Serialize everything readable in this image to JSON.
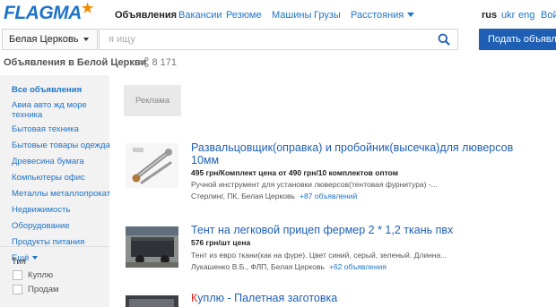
{
  "logo": {
    "text": "FLAGMA",
    "star": "★"
  },
  "nav": [
    {
      "label": "Объявления",
      "active": true
    },
    {
      "label": "Вакансии"
    },
    {
      "label": "Резюме"
    },
    {
      "label": "Машины"
    },
    {
      "label": "Грузы"
    },
    {
      "label": "Расстояния"
    }
  ],
  "langs": [
    "rus",
    "ukr",
    "eng"
  ],
  "login": "Вой",
  "search": {
    "city": "Белая Церковь",
    "placeholder": "я ищу",
    "post_button": "Подать объявлени"
  },
  "listing_header": {
    "title": "Объявления в Белой Церкви",
    "count": "8 171"
  },
  "sidebar": {
    "categories": [
      "Все объявления",
      "Авиа авто жд море",
      "техника",
      "Бытовая техника",
      "Бытовые товары одежда",
      "Древесина бумага",
      "Компьютеры офис",
      "Металлы металлопрокат",
      "Недвижимость",
      "Оборудование",
      "Продукты питания"
    ],
    "more": "Ещё",
    "type_title": "Тип",
    "type_options": [
      "Куплю",
      "Продам"
    ]
  },
  "ad_label": "Реклама",
  "items": [
    {
      "title": "Развальцовщик(оправка) и пробойник(высечка)для люверсов",
      "title2": "10мм",
      "price": "495 грн/Комплект цена  от 490 грн/10 комплектов оптом",
      "desc": "Ручной инструмент для установки люверсов(тентовая фурнитура) -...",
      "seller": "Стерлинг, ПК, Белая Церковь",
      "more": "+87 объявлений"
    },
    {
      "title": "Тент на легковой прицеп фермер 2 * 1,2 ткань пвх",
      "price": "576 грн/шт цена",
      "desc": "Тент из евро ткани(как на фуре). Цвет синий, серый, зеленый. Длинна...",
      "seller": "Лукашенко В.Б., ФЛП, Белая Церковь",
      "more": "+62 объявления"
    },
    {
      "title_first_letter": "К",
      "title_rest": "уплю - Палетная заготовка"
    }
  ],
  "colors": {
    "link": "#1e74c9",
    "button": "#1e5fb4",
    "logo_star": "#f08a00",
    "buy_marker": "#e0231a"
  }
}
